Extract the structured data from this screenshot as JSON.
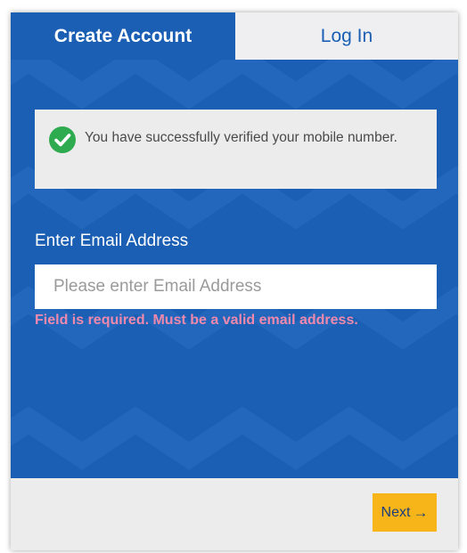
{
  "tabs": [
    {
      "label": "Create Account",
      "active": true
    },
    {
      "label": "Log In",
      "active": false
    }
  ],
  "notice": {
    "icon": "check-circle-icon",
    "text": "You have successfully verified your mobile number."
  },
  "email": {
    "label": "Enter Email Address",
    "value": "",
    "placeholder": "Please enter Email Address",
    "error": "Field is required. Must be a valid email address."
  },
  "footer": {
    "next_label": "Next",
    "next_icon": "→"
  },
  "colors": {
    "primary_blue": "#1a5fb4",
    "accent_yellow": "#f7b519",
    "success_green": "#2eaa4f",
    "error_pink": "#ee89ad"
  }
}
